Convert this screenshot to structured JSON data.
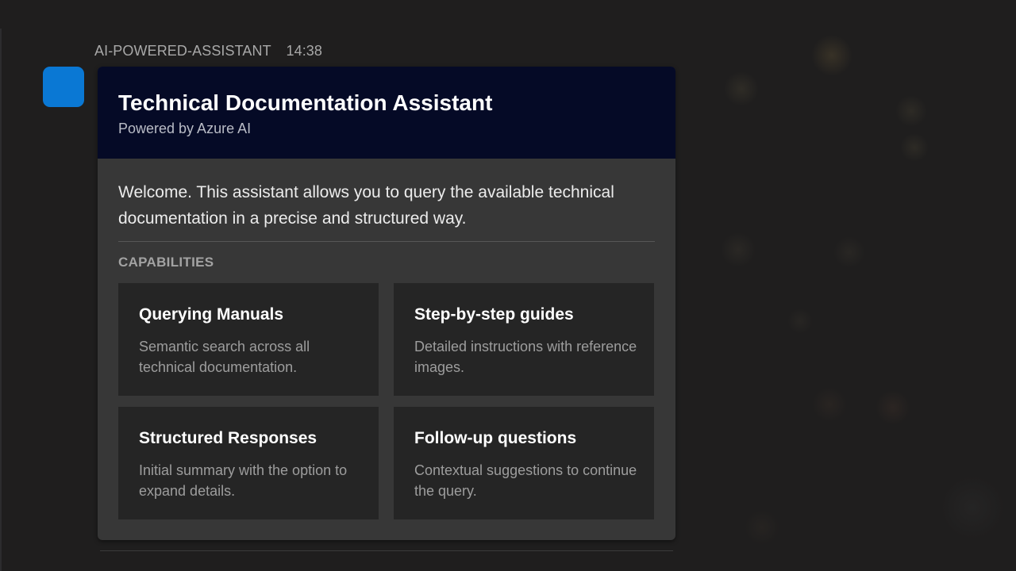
{
  "message": {
    "sender": "AI-POWERED-ASSISTANT",
    "time": "14:38"
  },
  "card": {
    "title": "Technical Documentation Assistant",
    "subtitle": "Powered by Azure AI",
    "welcome": "Welcome. This assistant allows you to query the available technical documentation in a precise and structured way.",
    "section_label": "CAPABILITIES",
    "capabilities": [
      {
        "title": "Querying Manuals",
        "description": "Semantic search across all technical documentation."
      },
      {
        "title": "Step-by-step guides",
        "description": "Detailed instructions with reference images."
      },
      {
        "title": "Structured Responses",
        "description": "Initial summary with the option to expand details."
      },
      {
        "title": "Follow-up questions",
        "description": "Contextual suggestions to continue the query."
      }
    ]
  },
  "colors": {
    "avatar": "#0a78d4",
    "header_background": "#050a26",
    "card_background": "#373737",
    "tile_background": "#252525",
    "page_background": "#1f1e1e"
  }
}
